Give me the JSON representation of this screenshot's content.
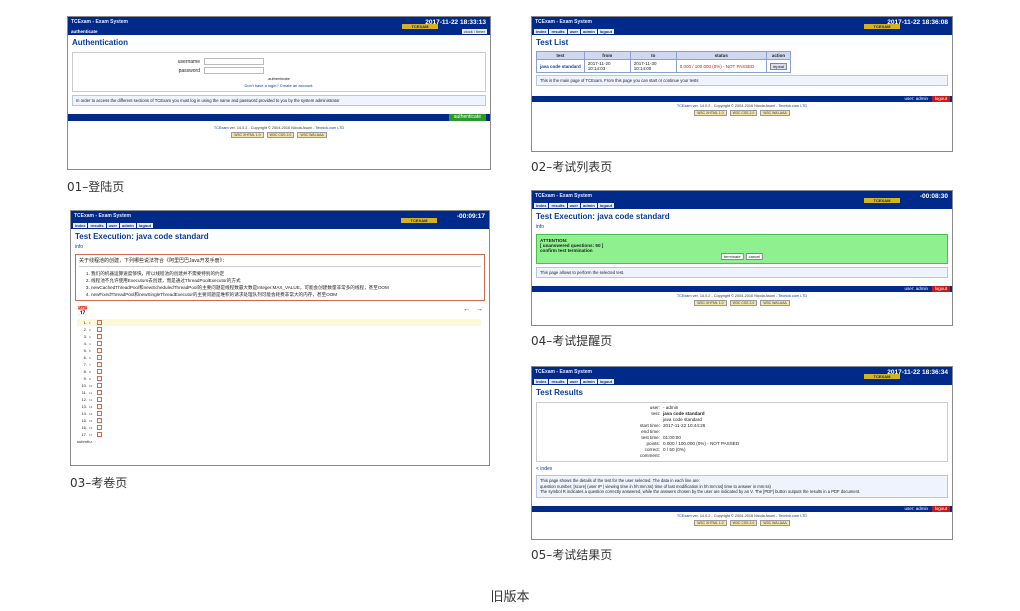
{
  "page_caption": "旧版本",
  "common": {
    "system_name": "TCExam - Exam System",
    "logo_text": "TCEXAM",
    "menu": [
      "index",
      "results",
      "user",
      "admin",
      "logout"
    ],
    "user_label": "user: admin",
    "logout_label": "logout",
    "credit_prefix": "TCExam",
    "credit_text": " ver. 14.0.2 - Copyright © 2004-2016 Nicola Asuni - ",
    "credit_link": "Tecnick.com LTD",
    "badges": [
      "W3C XHTML 1.0",
      "W3C CSS 2.0",
      "W3C WAI-AAA"
    ],
    "info_link": "info"
  },
  "screen1": {
    "caption": "01–登陆页",
    "clock": "2017-11-22 18:33:13",
    "sub_label": "authenticate",
    "clock_btn": "clock / timer",
    "title": "Authentication",
    "username_label": "username",
    "password_label": "password",
    "auth_link": "authenticate",
    "register_text": "Don't have a login? Create an account.",
    "notice": "In order to access the different sections of TCExam you must log in using the name and password provided to you by the system administrator",
    "auth_button": "authenticate"
  },
  "screen2": {
    "caption": "02–考试列表页",
    "clock": "2017-11-22 18:36:08",
    "title": "Test List",
    "columns": [
      "test",
      "from",
      "to",
      "status",
      "action"
    ],
    "rows": [
      {
        "test": "java code standard",
        "from": "2017-11-20 10:14:03",
        "to": "2017-11-30 10:14:00",
        "status": "0.000 / 100.000 (0%) - NOT PASSED",
        "action": "repeat"
      }
    ],
    "notice": "This is the main page of TCExam. From this page you can start or continue your tests"
  },
  "screen3": {
    "caption": "03–考卷页",
    "clock": "-00:09:17",
    "title": "Test Execution: java code standard",
    "question": "关于线程池的创建，下列哪些说法符合《阿里巴巴Java开发手册》：",
    "options": [
      "我们的机器运算速度够快，所以线程池的创建并不需要特别的约定",
      "线程池不允许使用Executors去创建，而是通过ThreadPoolExecutor的方式",
      "newCachedThreadPool和newScheduledThreadPool的主要问题是线程数最大数是Integer.MAX_VALUE，可能会创建数量非常多的线程，甚至OOM",
      "newFixedThreadPool和newSingleThreadExecutor的主要问题是堆积的请求处理队列可能会耗费非常大的内存，甚至OOM"
    ],
    "nav_prev": "←",
    "nav_next": "→",
    "question_numbers": [
      "1.",
      "2.",
      "3.",
      "4.",
      "5.",
      "6.",
      "7.",
      "8.",
      "9.",
      "10.",
      "11.",
      "12.",
      "13.",
      "14.",
      "15.",
      "16.",
      "17."
    ],
    "small_numbers": [
      "1",
      "2",
      "3",
      "4",
      "5",
      "6",
      "7",
      "8",
      "9",
      "10",
      "11",
      "12",
      "13",
      "14",
      "15",
      "16",
      "17"
    ],
    "last_label": "submit",
    "last_small": "18"
  },
  "screen4": {
    "caption": "04–考试提醒页",
    "clock": "-00:08:30",
    "title": "Test Execution: java code standard",
    "attention_title": "ATTENTION:",
    "attention_line1": "[ unanswered questions: 50 ]",
    "attention_line2": "confirm test termination",
    "terminate_btn": "terminate",
    "cancel_btn": "cancel",
    "notice": "This page allows to perform the selected test."
  },
  "screen5": {
    "caption": "05–考试结果页",
    "clock": "2017-11-22 18:36:34",
    "title": "Test Results",
    "results": [
      {
        "k": "user:",
        "v": "- admin",
        "bold": false
      },
      {
        "k": "test:",
        "v": "java code standard",
        "bold": true
      },
      {
        "k": "",
        "v": "java code standard",
        "bold": false
      },
      {
        "k": "start time:",
        "v": "2017-11-22 10:44:26",
        "bold": false
      },
      {
        "k": "end time:",
        "v": "",
        "bold": false
      },
      {
        "k": "test time:",
        "v": "01:00:00",
        "bold": false
      },
      {
        "k": "points:",
        "v": "0.000 / 100.000 (0%) - NOT PASSED",
        "bold": false
      },
      {
        "k": "correct:",
        "v": "0 / 50 (0%)",
        "bold": false
      },
      {
        "k": "comment:",
        "v": "",
        "bold": false
      }
    ],
    "index_link": "< index",
    "notice1": "This page shows the details of the test for the user selected. The data in each line are:",
    "notice2": "question number; [score] (user IP | viewing time in hh:mm:ss) time of last modification in hh:mm:ss] time to answer in mm:ss)",
    "notice3": "The symbol R indicates a question correctly answered, while the answers chosen by the user are indicated by an V. The [PDF] button outputs the results in a PDF document."
  }
}
